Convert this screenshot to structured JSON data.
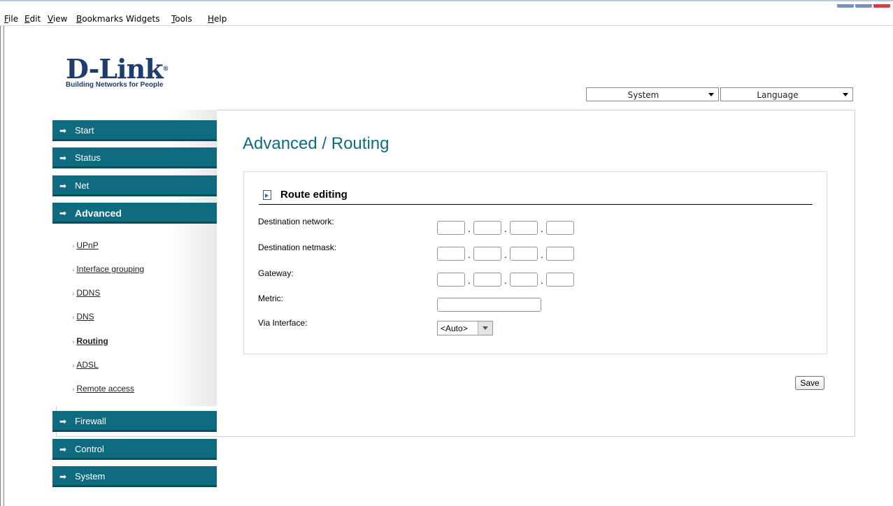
{
  "menubar": {
    "items": [
      {
        "acc": "F",
        "rest": "ile"
      },
      {
        "acc": "E",
        "rest": "dit"
      },
      {
        "acc": "V",
        "rest": "iew"
      },
      {
        "acc": "B",
        "rest": "ookmarks"
      },
      {
        "acc": "",
        "rest": "Widgets"
      },
      {
        "acc": "T",
        "rest": "ools"
      },
      {
        "acc": "H",
        "rest": "elp"
      }
    ]
  },
  "logo": {
    "word": "D-Link",
    "reg": "®",
    "tagline": "Building Networks for People"
  },
  "top_selects": {
    "system": "System",
    "language": "Language"
  },
  "nav": {
    "items": [
      "Start",
      "Status",
      "Net",
      "Advanced",
      "Firewall",
      "Control",
      "System"
    ],
    "active": "Advanced",
    "arrow_icon": "➡",
    "sub_bullet": "›",
    "sub_items": [
      "UPnP",
      "Interface grouping",
      "DDNS",
      "DNS",
      "Routing",
      "ADSL",
      "Remote access"
    ],
    "active_sub": "Routing"
  },
  "page": {
    "title": "Advanced / Routing"
  },
  "form": {
    "section_title": "Route editing",
    "labels": {
      "dest_network": "Destination network:",
      "dest_netmask": "Destination netmask:",
      "gateway": "Gateway:",
      "metric": "Metric:",
      "via_interface": "Via Interface:"
    },
    "dest_network": [
      "",
      "",
      "",
      ""
    ],
    "dest_netmask": [
      "",
      "",
      "",
      ""
    ],
    "gateway": [
      "",
      "",
      "",
      ""
    ],
    "metric": "",
    "via_interface_value": "<Auto>",
    "ip_separator": ".",
    "save_label": "Save"
  },
  "colors": {
    "accent": "#0f6b80",
    "nav_border": "#0a4e5e",
    "logo": "#1f3c6e"
  }
}
